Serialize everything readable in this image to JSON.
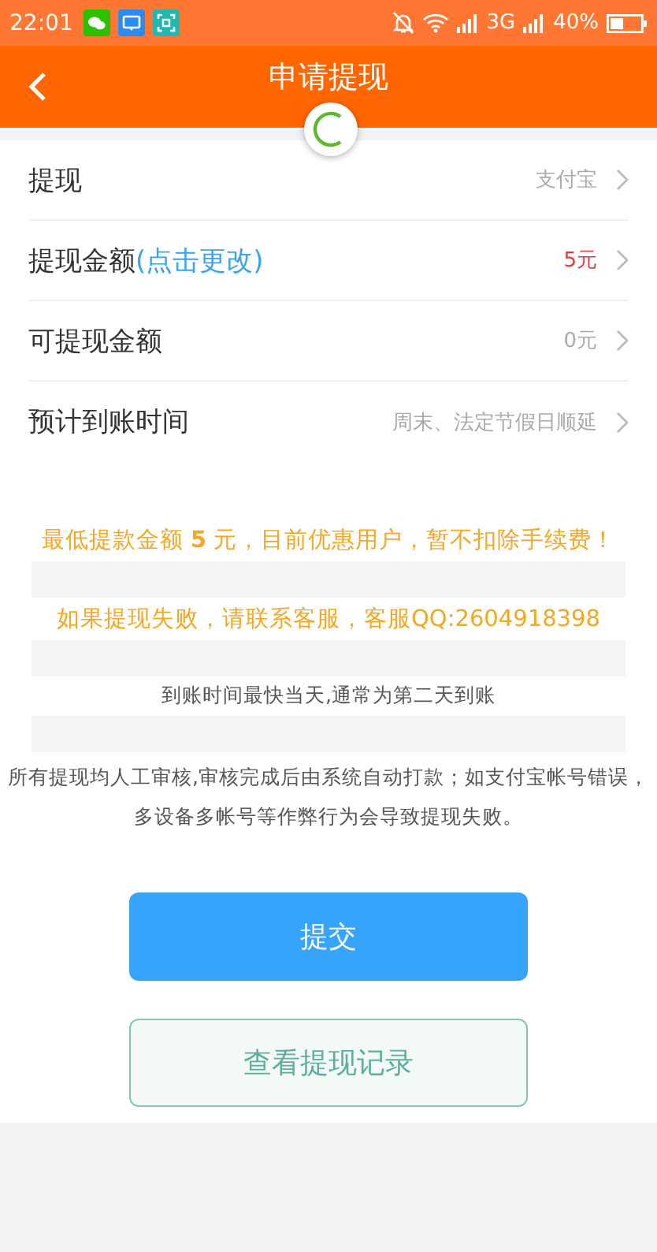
{
  "status_bar": {
    "time": "22:01",
    "network": "3G",
    "battery": "40%"
  },
  "header": {
    "title": "申请提现",
    "loading": true
  },
  "rows": [
    {
      "label": "提现",
      "value": "支付宝",
      "color": "#aaaaaa"
    },
    {
      "label": "提现金额",
      "link": "(点击更改)",
      "value": "5元",
      "color": "#e5383b"
    },
    {
      "label": "可提现金额",
      "value": "0元",
      "color": "#aaaaaa"
    },
    {
      "label": "预计到账时间",
      "value": "周末、法定节假日顺延",
      "color": "#aaaaaa"
    }
  ],
  "notices": [
    {
      "kind": "highlight",
      "text": "最低提款金额 **5** 元，目前优惠用户，暂不扣除手续费！"
    },
    {
      "kind": "highlight",
      "text": "如果提现失败，请联系客服，客服QQ:2604918398"
    },
    {
      "kind": "plain",
      "text": "到账时间最快当天,通常为第二天到账"
    },
    {
      "kind": "plain",
      "text": "所有提现均人工审核,审核完成后由系统自动打款；如支付宝帐号错误，多设备多帐号等作弊行为会导致提现失败。"
    }
  ],
  "buttons": [
    {
      "label": "提交",
      "kind": "primary"
    },
    {
      "label": "查看提现记录",
      "kind": "outline"
    }
  ]
}
